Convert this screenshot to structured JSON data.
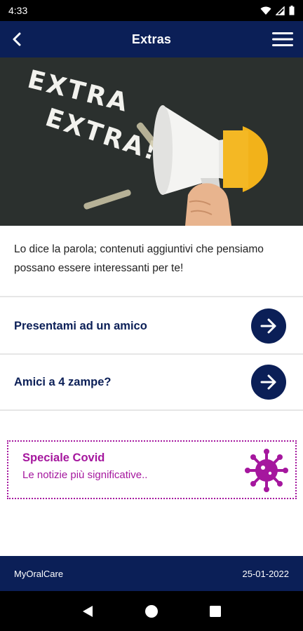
{
  "status_bar": {
    "time": "4:33"
  },
  "app_bar": {
    "title": "Extras"
  },
  "hero": {
    "chalk_line1": "EXTRA",
    "chalk_line2": "EXTRA!"
  },
  "intro_text": "Lo dice la parola; contenuti aggiuntivi che pensiamo possano essere interessanti per te!",
  "rows": [
    {
      "label": "Presentami ad un amico"
    },
    {
      "label": "Amici a 4 zampe?"
    }
  ],
  "covid_card": {
    "title": "Speciale Covid",
    "subtitle": "Le notizie più significative..",
    "accent_color": "#a5179e"
  },
  "footer": {
    "brand": "MyOralCare",
    "date": "25-01-2022"
  },
  "colors": {
    "primary": "#0b1f57",
    "accent": "#a5179e"
  }
}
